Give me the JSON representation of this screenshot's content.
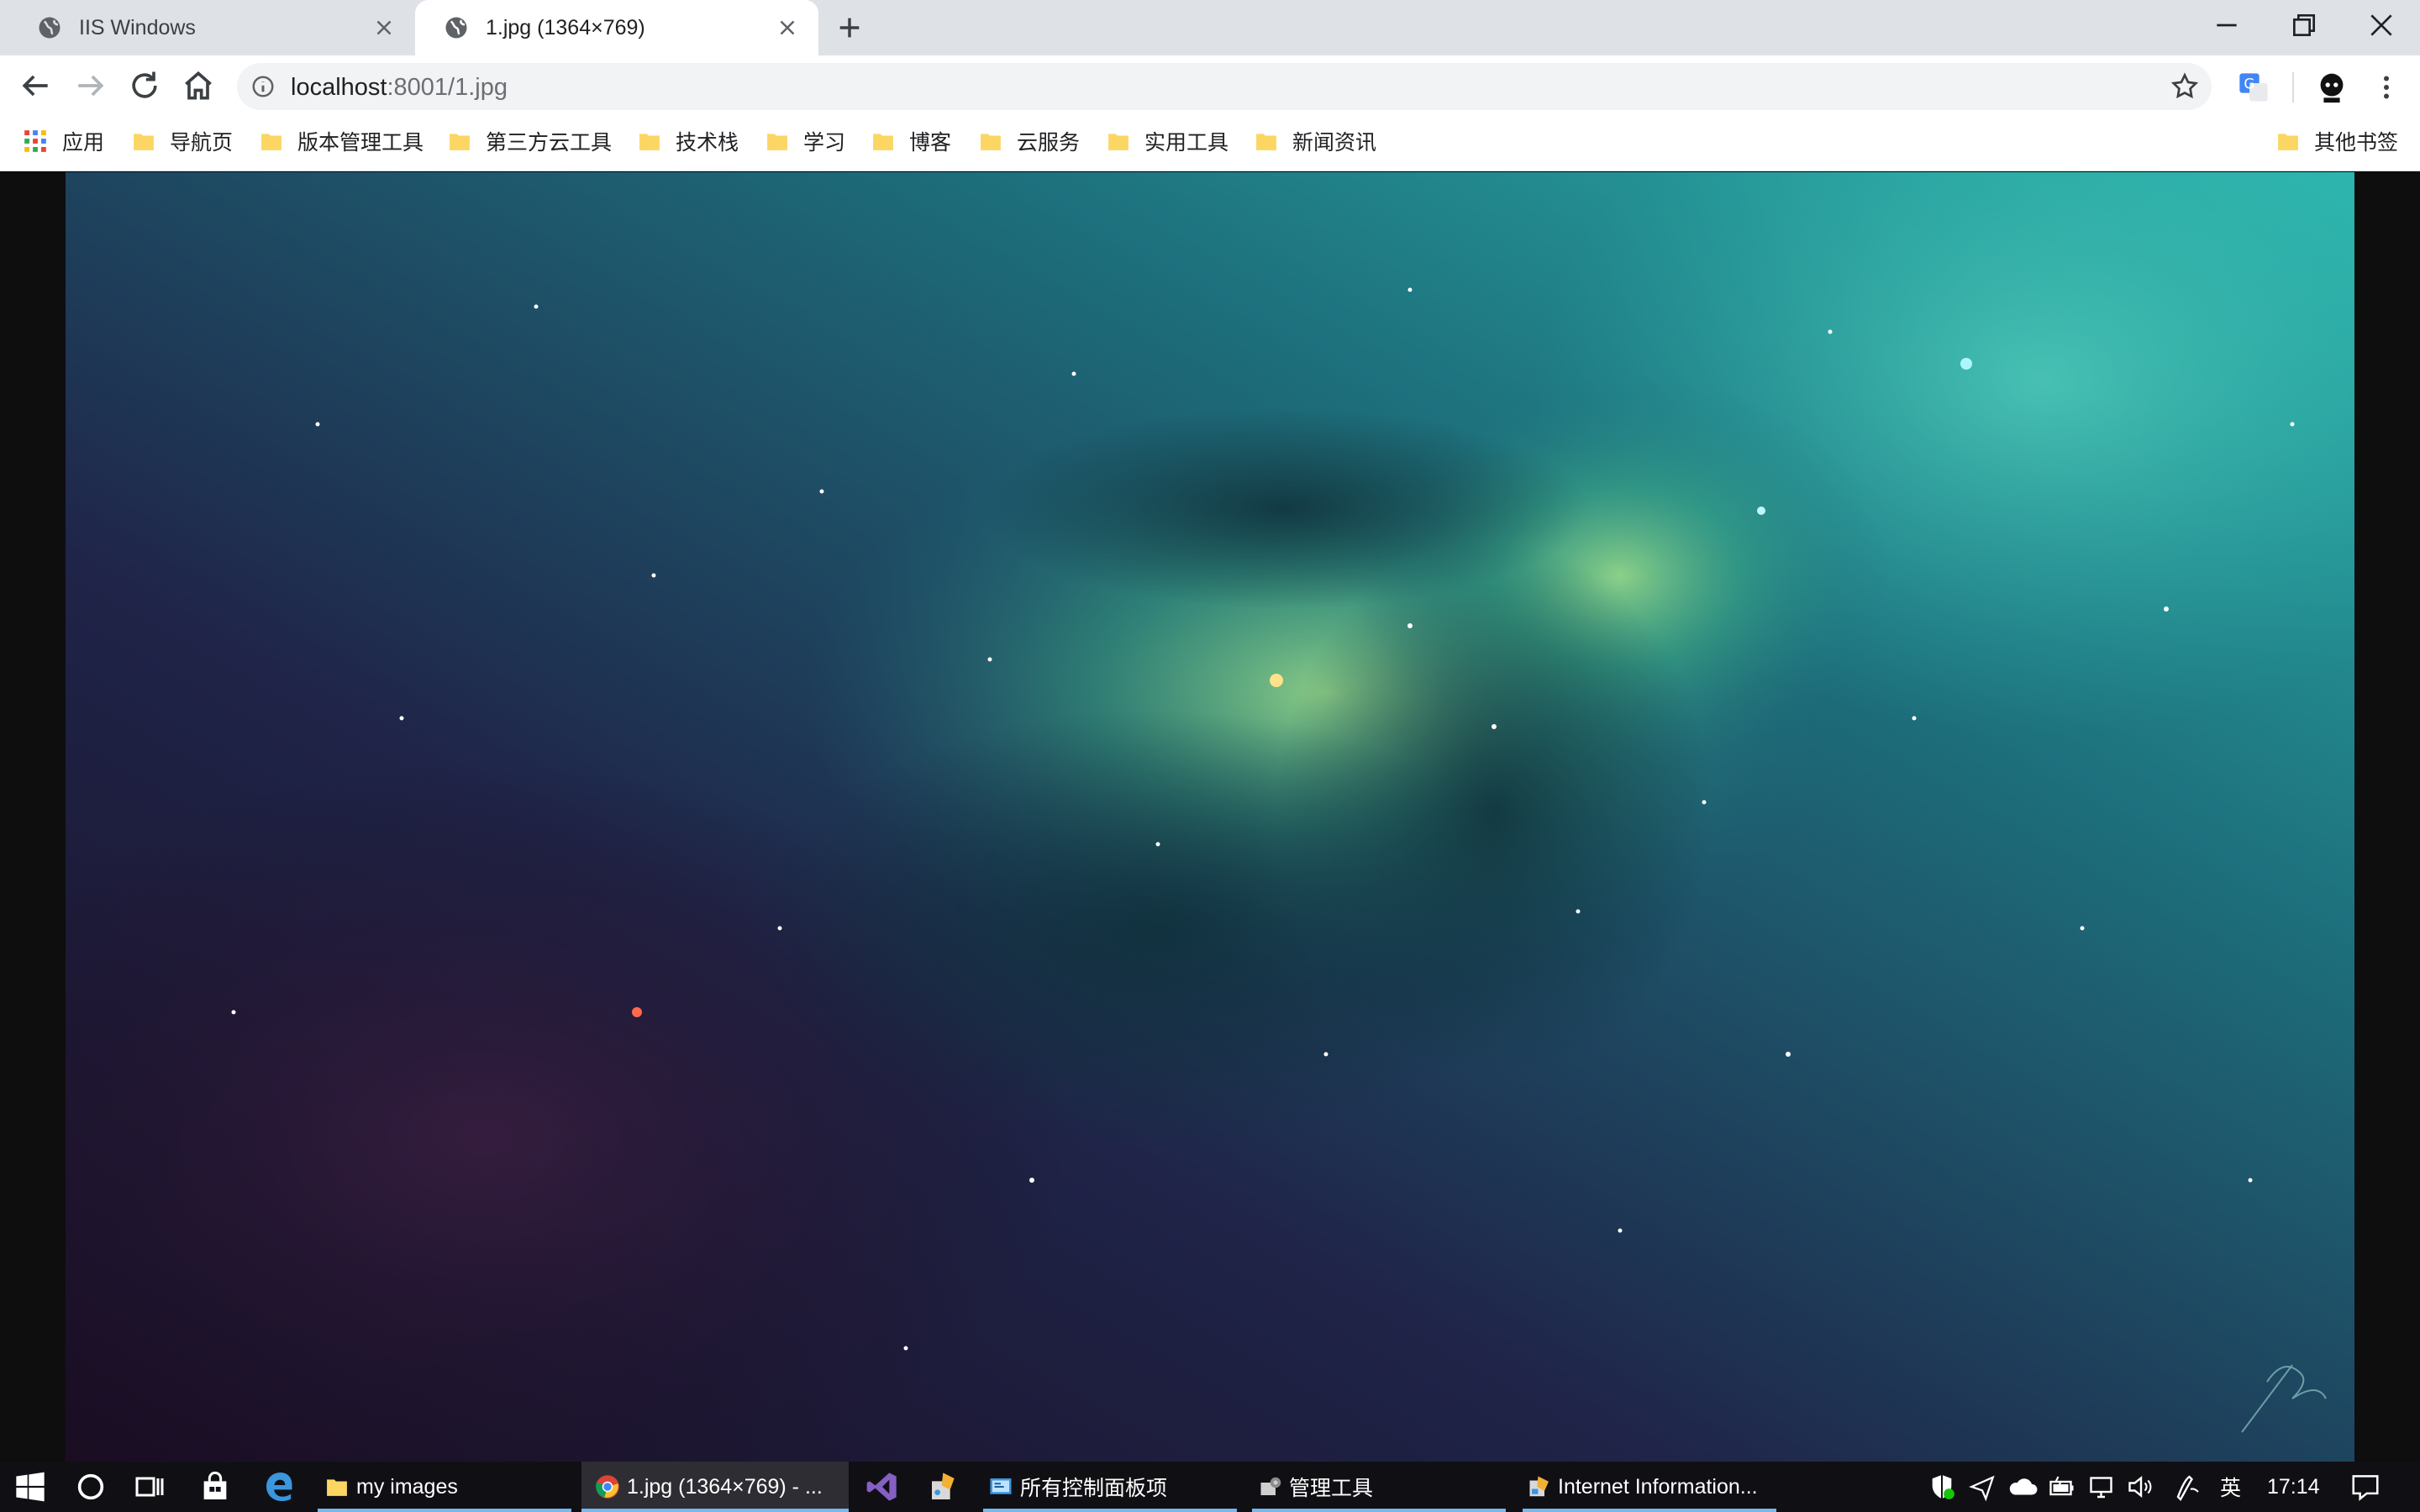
{
  "tabs": [
    {
      "title": "IIS Windows",
      "active": false
    },
    {
      "title": "1.jpg (1364×769)",
      "active": true
    }
  ],
  "toolbar": {
    "url_host": "localhost",
    "url_rest": ":8001/1.jpg"
  },
  "bookmarks": {
    "apps_label": "应用",
    "items": [
      "导航页",
      "版本管理工具",
      "第三方云工具",
      "技术栈",
      "学习",
      "博客",
      "云服务",
      "实用工具",
      "新闻资讯"
    ],
    "other_label": "其他书签"
  },
  "taskbar": {
    "items": [
      {
        "label": "my images"
      },
      {
        "label": "1.jpg (1364×769) - ..."
      },
      {
        "label": "所有控制面板项"
      },
      {
        "label": "管理工具"
      },
      {
        "label": "Internet Information..."
      }
    ],
    "tray": {
      "ime": "英",
      "time": "17:14"
    }
  },
  "colors": {
    "tabstrip": "#dee1e6",
    "nebula_teal": "#2fb3a6",
    "nebula_purple": "#2a1a3a",
    "taskbar": "#101014"
  }
}
